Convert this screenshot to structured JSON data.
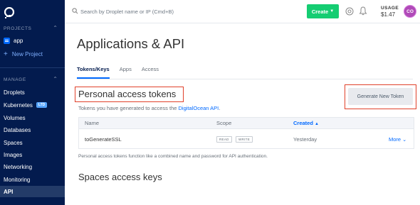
{
  "sidebar": {
    "projects_label": "PROJECTS",
    "project_name": "app",
    "new_project": "New Project",
    "manage_label": "MANAGE",
    "items": [
      {
        "label": "Droplets"
      },
      {
        "label": "Kubernetes",
        "badge": "LTD"
      },
      {
        "label": "Volumes"
      },
      {
        "label": "Databases"
      },
      {
        "label": "Spaces"
      },
      {
        "label": "Images"
      },
      {
        "label": "Networking"
      },
      {
        "label": "Monitoring"
      },
      {
        "label": "API",
        "active": true
      }
    ]
  },
  "topbar": {
    "search_placeholder": "Search by Droplet name or IP (Cmd+B)",
    "create_label": "Create",
    "usage_label": "USAGE",
    "usage_value": "$1.47",
    "avatar_initials": "CO"
  },
  "page": {
    "title": "Applications & API",
    "tabs": [
      "Tokens/Keys",
      "Apps",
      "Access"
    ]
  },
  "tokens": {
    "title": "Personal access tokens",
    "subtitle_prefix": "Tokens you have generated to access the ",
    "subtitle_link": "DigitalOcean API",
    "subtitle_suffix": ".",
    "generate_label": "Generate New Token",
    "columns": {
      "name": "Name",
      "scope": "Scope",
      "created": "Created"
    },
    "rows": [
      {
        "name": "toGenerateSSL",
        "scopes": [
          "READ",
          "WRITE"
        ],
        "created": "Yesterday",
        "more": "More"
      }
    ],
    "note": "Personal access tokens function like a combined name and password for API authentication."
  },
  "spaces": {
    "title": "Spaces access keys"
  },
  "colors": {
    "sidebar_bg": "#031b4e",
    "accent": "#0069ff",
    "create_green": "#15cd72",
    "highlight_red": "#e0402a"
  }
}
